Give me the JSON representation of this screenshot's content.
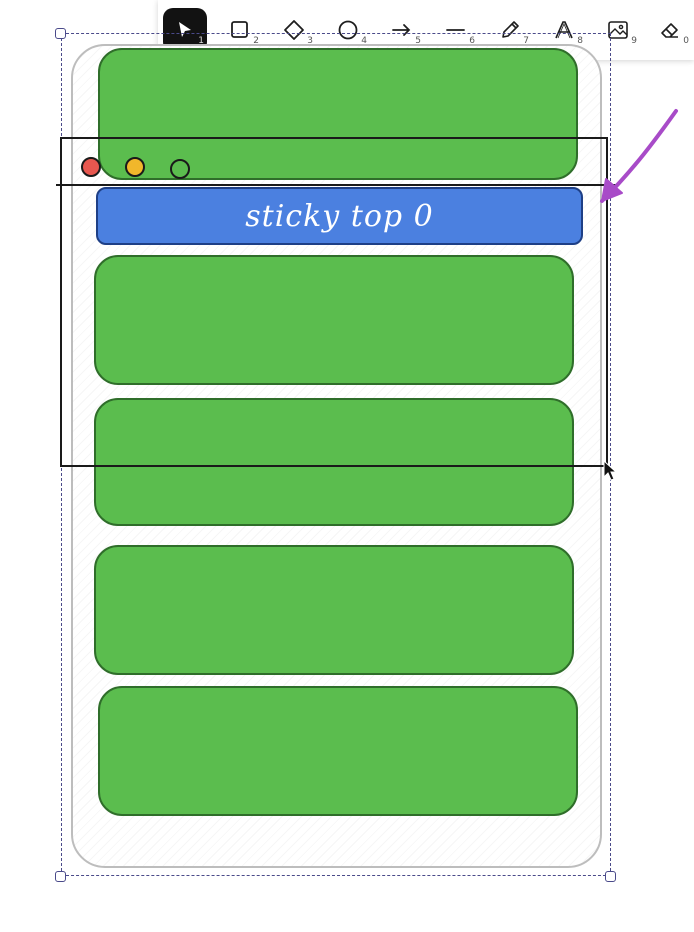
{
  "toolbar": {
    "tools": [
      {
        "name": "selection",
        "icon": "pointer-icon",
        "key": "1",
        "active": true
      },
      {
        "name": "rectangle",
        "icon": "rectangle-icon",
        "key": "2"
      },
      {
        "name": "diamond",
        "icon": "diamond-icon",
        "key": "3"
      },
      {
        "name": "ellipse",
        "icon": "ellipse-icon",
        "key": "4"
      },
      {
        "name": "arrow",
        "icon": "arrow-icon",
        "key": "5"
      },
      {
        "name": "line",
        "icon": "line-icon",
        "key": "6"
      },
      {
        "name": "draw",
        "icon": "pencil-icon",
        "key": "7"
      },
      {
        "name": "text",
        "icon": "text-icon",
        "key": "8"
      },
      {
        "name": "image",
        "icon": "image-icon",
        "key": "9"
      },
      {
        "name": "eraser",
        "icon": "eraser-icon",
        "key": "0"
      }
    ]
  },
  "canvas": {
    "sticky_label": "sticky top 0",
    "colors": {
      "card_green": "#5bbd4e",
      "sticky_blue": "#4b80e0",
      "arrow_purple": "#a84bc8",
      "dot_red": "#e8574f",
      "dot_yellow": "#f1b72b"
    },
    "cards": [
      "card",
      "card",
      "card",
      "card",
      "card",
      "card"
    ]
  }
}
